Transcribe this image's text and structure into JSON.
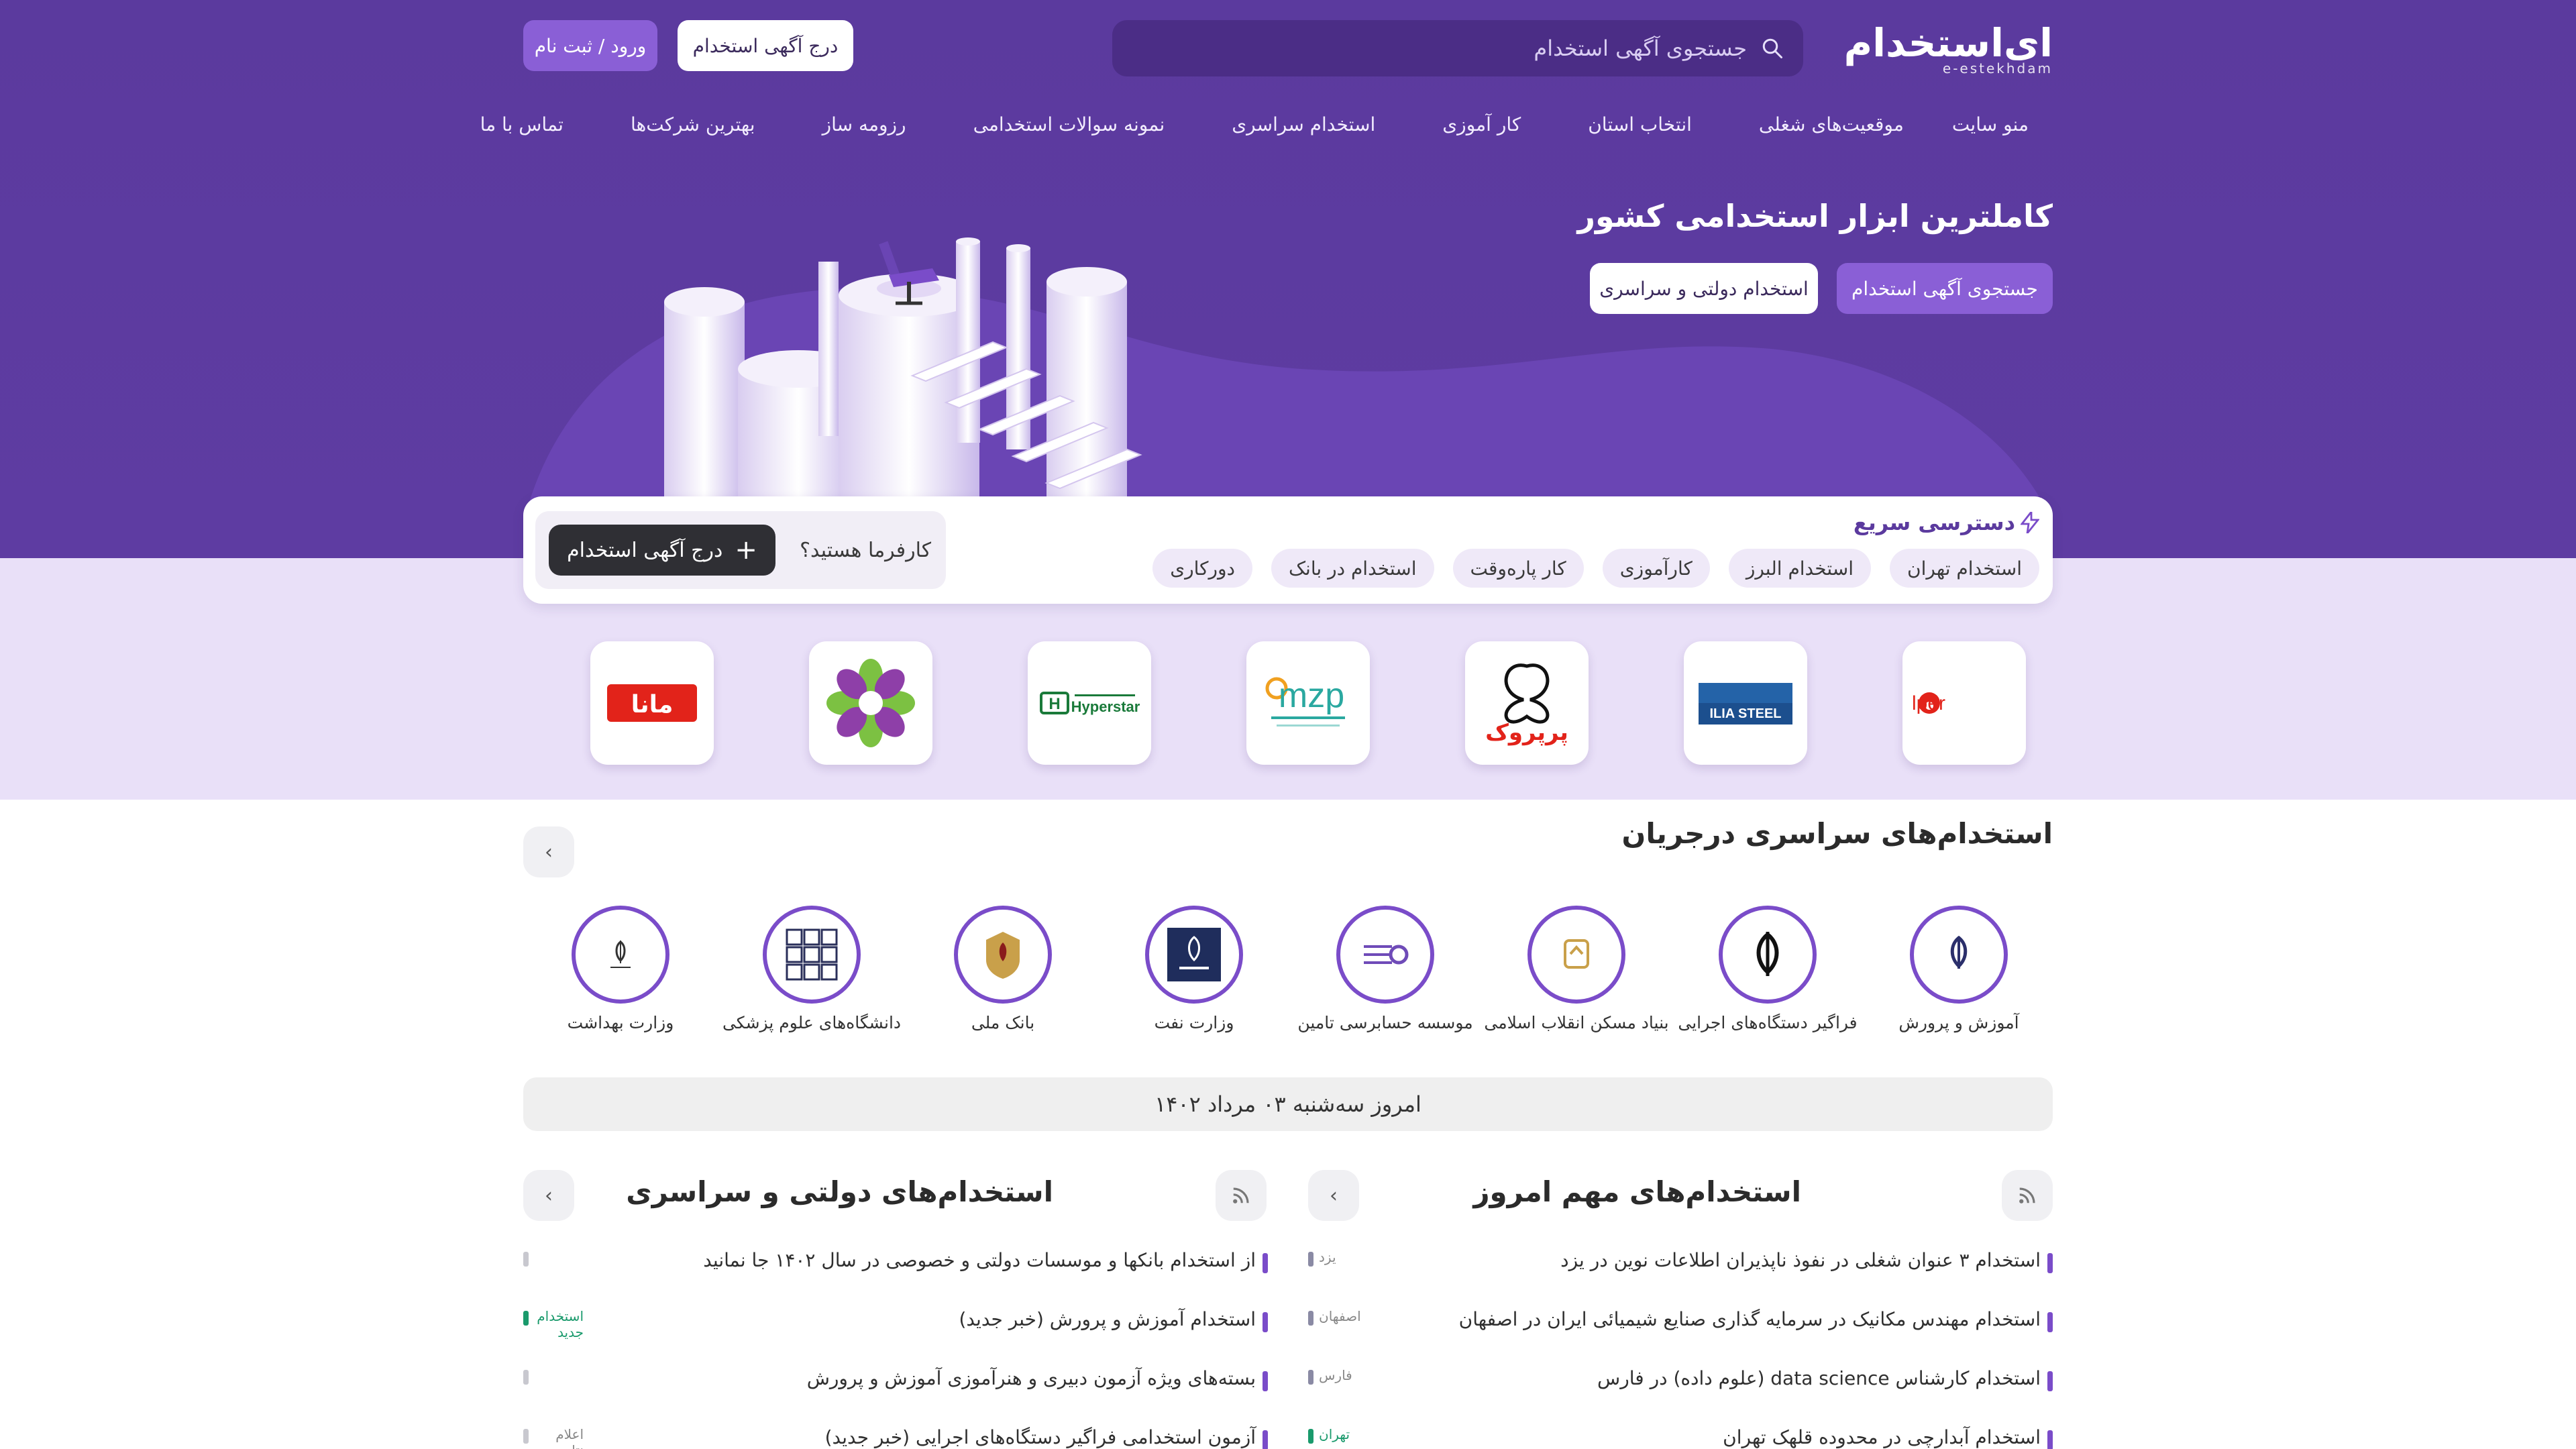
{
  "header": {
    "logo_text": "ای‌استخدام",
    "logo_sub": "e-estekhdam",
    "search_placeholder": "جستجوی آگهی استخدام",
    "post_ad": "درج آگهی استخدام",
    "login": "ورود / ثبت نام"
  },
  "nav": {
    "items": [
      "منو سایت",
      "موقعیت‌های شغلی",
      "انتخاب استان",
      "کار آموزی",
      "استخدام سراسری",
      "نمونه سوالات استخدامی",
      "رزومه ساز",
      "بهترین شرکت‌ها",
      "تماس با ما"
    ]
  },
  "hero": {
    "title": "کاملترین ابزار استخدامی کشور",
    "btn_search": "جستجوی آگهی استخدام",
    "btn_gov": "استخدام دولتی و سراسری"
  },
  "quick": {
    "title": "دسترسی سریع",
    "chips": [
      "استخدام تهران",
      "استخدام البرز",
      "کارآموزی",
      "کار پاره‌وقت",
      "استخدام در بانک",
      "دورکاری"
    ],
    "employer_q": "کارفرما هستید؟",
    "employer_btn": "درج آگهی استخدام"
  },
  "company_logos": [
    {
      "name": "nilper",
      "text": "nilper"
    },
    {
      "name": "ilia-steel",
      "text": "ILIA STEEL"
    },
    {
      "name": "perperook",
      "text": "پرپروک"
    },
    {
      "name": "mzp",
      "text": "mzp"
    },
    {
      "name": "hyperstar",
      "text": "Hyperstar"
    },
    {
      "name": "ornament",
      "text": ""
    },
    {
      "name": "mana",
      "text": "مانا"
    }
  ],
  "ongoing": {
    "title": "استخدام‌های سراسری درجریان",
    "orgs": [
      "آموزش و پرورش",
      "فراگیر دستگاه‌های اجرایی",
      "بنیاد مسکن انقلاب اسلامی",
      "موسسه حسابرسی تامین",
      "وزارت نفت",
      "بانک ملی",
      "دانشگاه‌های علوم پزشکی",
      "وزارت بهداشت"
    ]
  },
  "today": "امروز سه‌شنبه ۰۳ مرداد ۱۴۰۲",
  "important": {
    "title": "استخدام‌های مهم امروز",
    "rows": [
      {
        "title": "استخدام ۳ عنوان شغلی در نفوذ ناپذیران اطلاعات نوین در یزد",
        "tag": "یزد"
      },
      {
        "title": "استخدام مهندس مکانیک در سرمایه گذاری صنایع شیمیائی ایران در اصفهان",
        "tag": "اصفهان"
      },
      {
        "title": "استخدام کارشناس data science (علوم داده) در فارس",
        "tag": "فارس"
      },
      {
        "title": "استخدام آبدارچی در محدوده قلهک تهران",
        "tag": "تهران"
      }
    ]
  },
  "government": {
    "title": "استخدام‌های دولتی و سراسری",
    "rows": [
      {
        "title": "از استخدام بانکها و موسسات دولتی و خصوصی در سال ۱۴۰۲ جا نمانید",
        "tag": ""
      },
      {
        "title": "استخدام آموزش و پرورش (خبر جدید)",
        "tag": "استخدام جدید"
      },
      {
        "title": "بسته‌های ویژه آزمون دبیری و هنرآموزی آموزش و پرورش",
        "tag": ""
      },
      {
        "title": "آزمون استخدامی فراگیر دستگاه‌های اجرایی (خبر جدید)",
        "tag": "اعلام نتایج"
      }
    ]
  },
  "colors": {
    "brand": "#5b3a9e",
    "accent": "#8a5fd6",
    "lavender": "#e9e0f8"
  }
}
